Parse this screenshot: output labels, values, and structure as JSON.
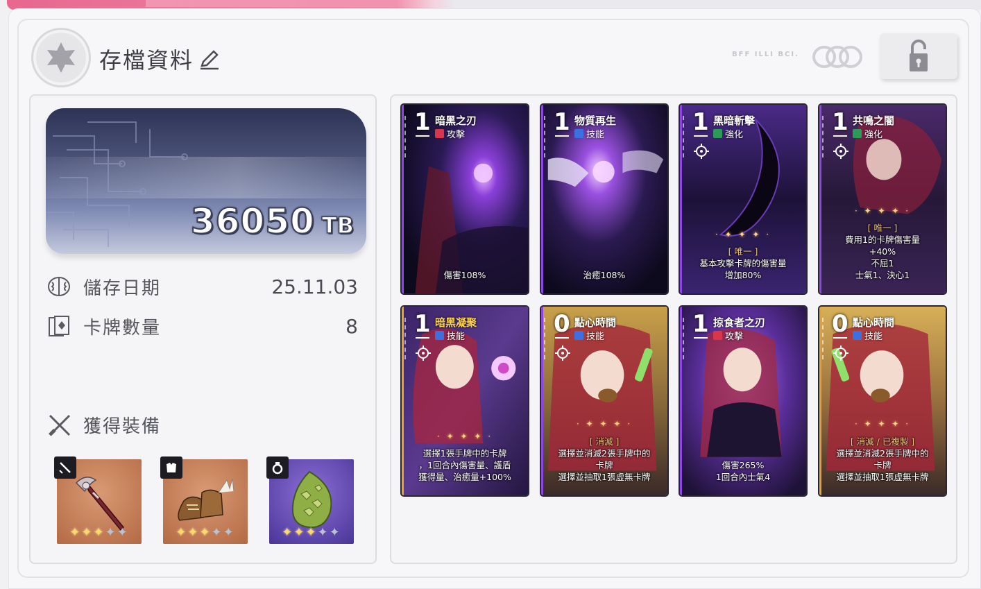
{
  "header": {
    "title": "存檔資料",
    "faint_text": "BFF ILLI BCI."
  },
  "balance": {
    "amount": "36050",
    "unit": "TB"
  },
  "info": {
    "save_date_label": "儲存日期",
    "save_date_value": "25.11.03",
    "card_count_label": "卡牌數量",
    "card_count_value": "8"
  },
  "equipment": {
    "label": "獲得裝備",
    "items": [
      {
        "category": "weapon",
        "stars_on": 3,
        "stars_total": 5,
        "color": "#c9774e"
      },
      {
        "category": "armor",
        "stars_on": 3,
        "stars_total": 5,
        "color": "#c9774e"
      },
      {
        "category": "accessory",
        "stars_on": 3,
        "stars_total": 5,
        "color": "#6b4fb8"
      }
    ]
  },
  "cards": [
    {
      "cost": "1",
      "name": "暗黑之刃",
      "type": "攻擊",
      "type_icon": "sword-icon",
      "desc": [
        "傷害108%"
      ]
    },
    {
      "cost": "1",
      "name": "物質再生",
      "type": "技能",
      "type_icon": "skill-icon",
      "desc": [
        "治癒108%"
      ]
    },
    {
      "cost": "1",
      "name": "黑暗斬擊",
      "type": "強化",
      "type_icon": "bolt-icon",
      "tag": "[ 唯一 ]",
      "desc": [
        "基本攻擊卡牌的傷害量",
        "增加80%"
      ]
    },
    {
      "cost": "1",
      "name": "共鳴之闇",
      "type": "強化",
      "type_icon": "bolt-icon",
      "tag": "[ 唯一 ]",
      "desc": [
        "費用1的卡牌傷害量",
        "+40%",
        "不屈1",
        "士氣1、決心1"
      ]
    },
    {
      "cost": "1",
      "name": "暗黑凝聚",
      "type": "技能",
      "type_icon": "skill-icon",
      "desc": [
        "選擇1張手牌中的卡牌",
        "，1回合內傷害量、護盾",
        "獲得量、治癒量+100%"
      ]
    },
    {
      "cost": "0",
      "name": "點心時間",
      "type": "技能",
      "type_icon": "skill-icon",
      "tag": "[ 消滅 ]",
      "desc": [
        "選擇並消滅2張手牌中的",
        "卡牌",
        "選擇並抽取1張虛無卡牌"
      ]
    },
    {
      "cost": "1",
      "name": "掠食者之刃",
      "type": "攻擊",
      "type_icon": "sword-icon",
      "desc": [
        "傷害265%",
        "1回合內士氣4"
      ]
    },
    {
      "cost": "0",
      "name": "點心時間",
      "type": "技能",
      "type_icon": "skill-icon",
      "tag": "[ 消滅 / 已複製 ]",
      "desc": [
        "選擇並消滅2張手牌中的",
        "卡牌",
        "選擇並抽取1張虛無卡牌"
      ]
    }
  ]
}
